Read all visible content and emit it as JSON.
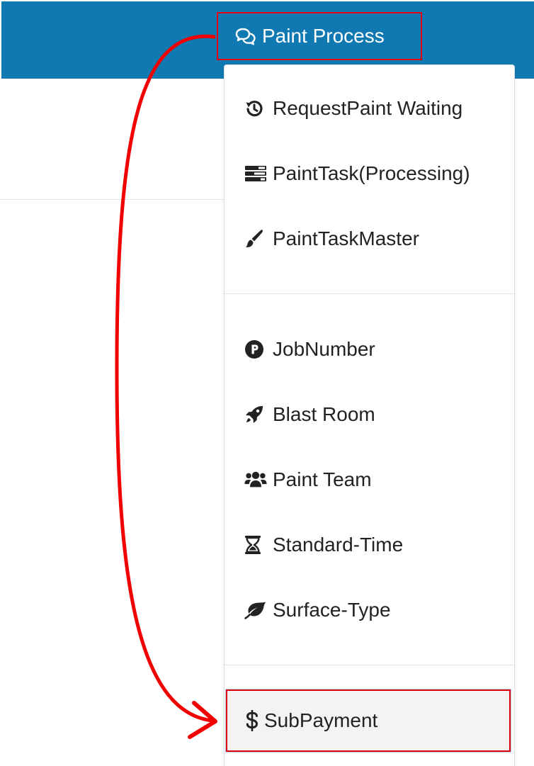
{
  "header": {
    "nav_label": "Paint Process",
    "nav_icon": "comments-icon",
    "bar_color": "#1179b2"
  },
  "dropdown": {
    "items": [
      {
        "label": "RequestPaint Waiting",
        "icon": "history-icon"
      },
      {
        "label": "PaintTask(Processing)",
        "icon": "tasks-icon"
      },
      {
        "label": "PaintTaskMaster",
        "icon": "paint-brush-icon"
      },
      {
        "label": "JobNumber",
        "icon": "product-hunt-icon"
      },
      {
        "label": "Blast Room",
        "icon": "rocket-icon"
      },
      {
        "label": "Paint Team",
        "icon": "users-icon"
      },
      {
        "label": "Standard-Time",
        "icon": "hourglass-icon"
      },
      {
        "label": "Surface-Type",
        "icon": "leaf-icon"
      },
      {
        "label": "SubPayment",
        "icon": "dollar-icon"
      }
    ]
  },
  "annotation": {
    "highlight_color": "#e0000f"
  }
}
